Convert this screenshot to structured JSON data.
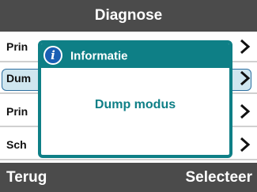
{
  "header": {
    "title": "Diagnose"
  },
  "menu": {
    "items": [
      {
        "label": "Prin",
        "chevron_icon": "chevron-right-icon"
      },
      {
        "label": "Dum",
        "chevron_icon": "chevron-right-icon",
        "selected": true
      },
      {
        "label": "Prin",
        "chevron_icon": "chevron-right-icon"
      },
      {
        "label": "Sch",
        "chevron_icon": "chevron-right-icon"
      }
    ]
  },
  "dialog": {
    "icon": "info-icon",
    "icon_glyph": "i",
    "title": "Informatie",
    "message": "Dump modus"
  },
  "footer": {
    "back_label": "Terug",
    "select_label": "Selecteer"
  },
  "colors": {
    "bar": "#4b4b4b",
    "accent": "#0e7f86",
    "selection": "#cfe6ef",
    "info_icon": "#1a5fb4"
  }
}
